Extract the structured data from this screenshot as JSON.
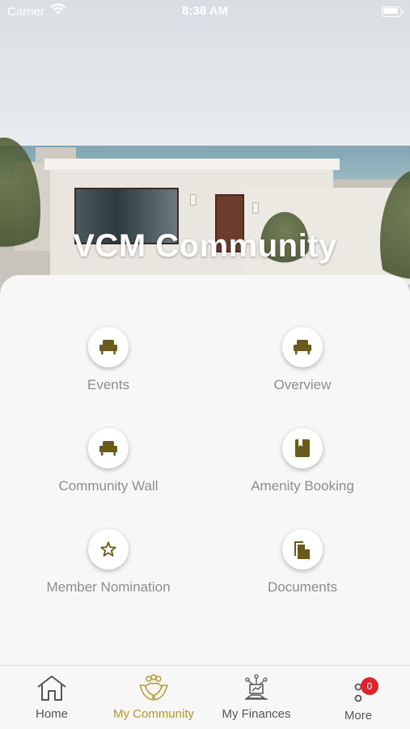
{
  "status_bar": {
    "carrier": "Carrier",
    "time": "8:38 AM"
  },
  "hero": {
    "title": "VCM Community"
  },
  "menu": [
    {
      "label": "Events",
      "icon": "chair-icon"
    },
    {
      "label": "Overview",
      "icon": "chair-icon"
    },
    {
      "label": "Community Wall",
      "icon": "chair-icon"
    },
    {
      "label": "Amenity Booking",
      "icon": "book-icon"
    },
    {
      "label": "Member Nomination",
      "icon": "star-icon"
    },
    {
      "label": "Documents",
      "icon": "documents-icon"
    }
  ],
  "bottom_nav": {
    "items": [
      {
        "label": "Home",
        "icon": "home-icon"
      },
      {
        "label": "My Community",
        "icon": "community-hands-icon",
        "active": true
      },
      {
        "label": "My Finances",
        "icon": "finance-icon"
      },
      {
        "label": "More",
        "icon": "more-icon",
        "badge": "0"
      }
    ]
  },
  "colors": {
    "accent": "#6b5a1e",
    "active_nav": "#b8962e",
    "badge": "#e0242b"
  }
}
